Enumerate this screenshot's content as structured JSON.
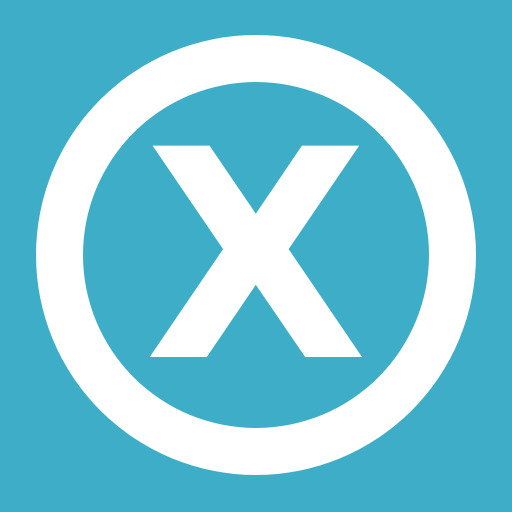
{
  "icon": {
    "name": "x-in-circle-icon",
    "letter": "X",
    "colors": {
      "background": "#3eaec8",
      "foreground": "#ffffff"
    }
  }
}
